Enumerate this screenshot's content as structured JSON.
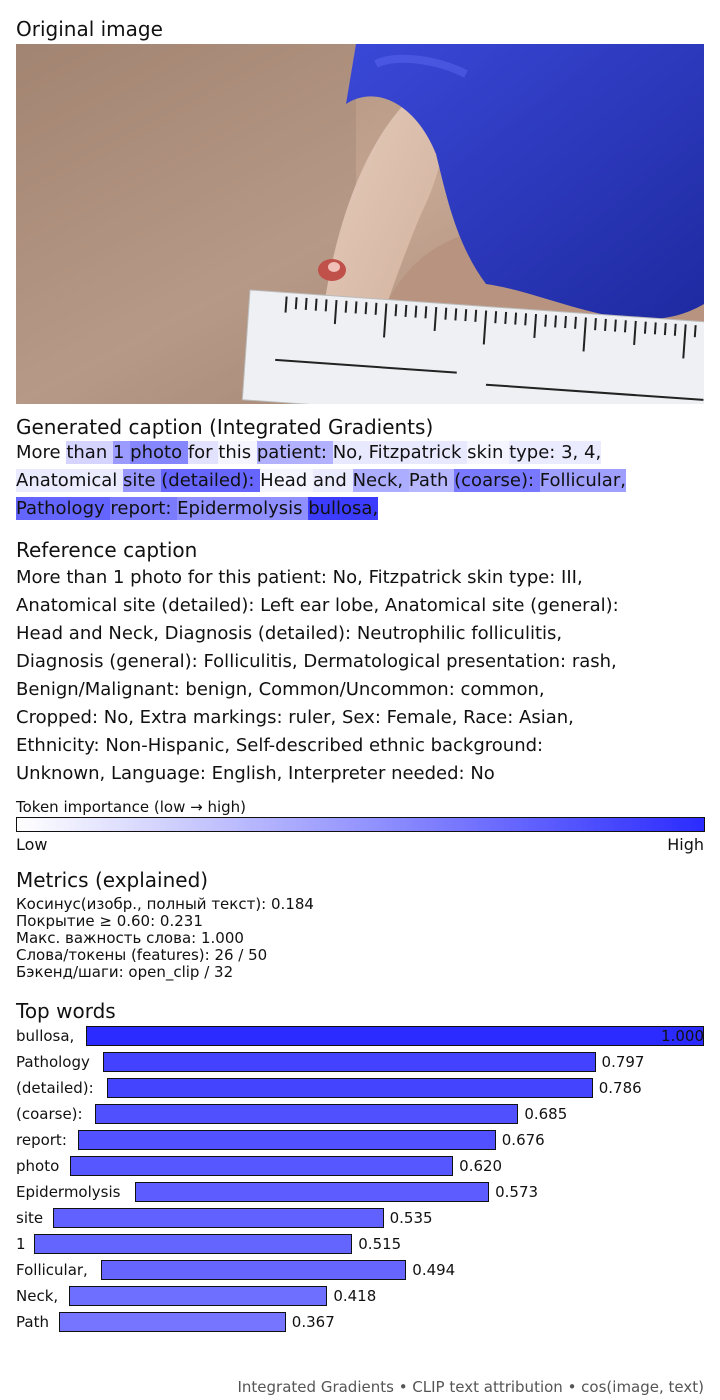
{
  "original_title": "Original image",
  "generated_title": "Generated caption (Integrated Gradients)",
  "generated_tokens": [
    {
      "t": "More",
      "w": 0
    },
    {
      "t": "than",
      "w": 0.22
    },
    {
      "t": "1",
      "w": 0.515
    },
    {
      "t": "photo",
      "w": 0.62
    },
    {
      "t": "for",
      "w": 0.15
    },
    {
      "t": "this",
      "w": 0.05
    },
    {
      "t": "patient:",
      "w": 0.4
    },
    {
      "t": "No,",
      "w": 0.12
    },
    {
      "t": "Fitzpatrick",
      "w": 0.12
    },
    {
      "t": "skin",
      "w": 0.05
    },
    {
      "t": "type:",
      "w": 0.1
    },
    {
      "t": "3,",
      "w": 0.1
    },
    {
      "t": "4,",
      "w": 0.1
    },
    {
      "t": "Anatomical",
      "w": 0.1
    },
    {
      "t": "site",
      "w": 0.535
    },
    {
      "t": "(detailed):",
      "w": 0.786
    },
    {
      "t": "Head",
      "w": 0.05
    },
    {
      "t": "and",
      "w": 0.1
    },
    {
      "t": "Neck,",
      "w": 0.418
    },
    {
      "t": "Path",
      "w": 0.367
    },
    {
      "t": "(coarse):",
      "w": 0.685
    },
    {
      "t": "Follicular,",
      "w": 0.494
    },
    {
      "t": "Pathology",
      "w": 0.797
    },
    {
      "t": "report:",
      "w": 0.676
    },
    {
      "t": "Epidermolysis",
      "w": 0.573
    },
    {
      "t": "bullosa,",
      "w": 1.0
    }
  ],
  "reference_title": "Reference caption",
  "reference_text": "More than 1 photo for this patient: No, Fitzpatrick skin type: III,\nAnatomical site (detailed): Left ear lobe, Anatomical site (general):\nHead and Neck, Diagnosis (detailed): Neutrophilic folliculitis,\nDiagnosis (general): Folliculitis, Dermatological presentation: rash,\nBenign/Malignant: benign, Common/Uncommon: common,\nCropped: No, Extra markings: ruler, Sex: Female, Race: Asian,\nEthnicity: Non-Hispanic, Self-described ethnic background:\nUnknown, Language: English, Interpreter needed: No",
  "colorbar": {
    "label": "Token importance (low → high)",
    "low": "Low",
    "high": "High"
  },
  "metrics": {
    "title": "Metrics (explained)",
    "lines": [
      "Косинус(изобр., полный текст): 0.184",
      "Покрытие ≥ 0.60: 0.231",
      "Макс. важность слова: 1.000",
      "Слова/токены (features): 26 / 50",
      "Бэкенд/шаги: open_clip / 32"
    ]
  },
  "top_words_title": "Top words",
  "chart_data": {
    "type": "bar",
    "title": "Top words",
    "categories": [
      "bullosa,",
      "Pathology",
      "(detailed):",
      "(coarse):",
      "report:",
      "photo",
      "Epidermolysis",
      "site",
      "1",
      "Follicular,",
      "Neck,",
      "Path"
    ],
    "values": [
      1.0,
      0.797,
      0.786,
      0.685,
      0.676,
      0.62,
      0.573,
      0.535,
      0.515,
      0.494,
      0.418,
      0.367
    ],
    "value_labels": [
      "1.000",
      "0.797",
      "0.786",
      "0.685",
      "0.676",
      "0.620",
      "0.573",
      "0.535",
      "0.515",
      "0.494",
      "0.418",
      "0.367"
    ],
    "xlim": [
      0,
      1
    ],
    "orientation": "horizontal"
  },
  "footer": "Integrated Gradients • CLIP text attribution • cos(image, text)",
  "colors": {
    "high": "#2b2bff",
    "low": "#ffffff"
  }
}
